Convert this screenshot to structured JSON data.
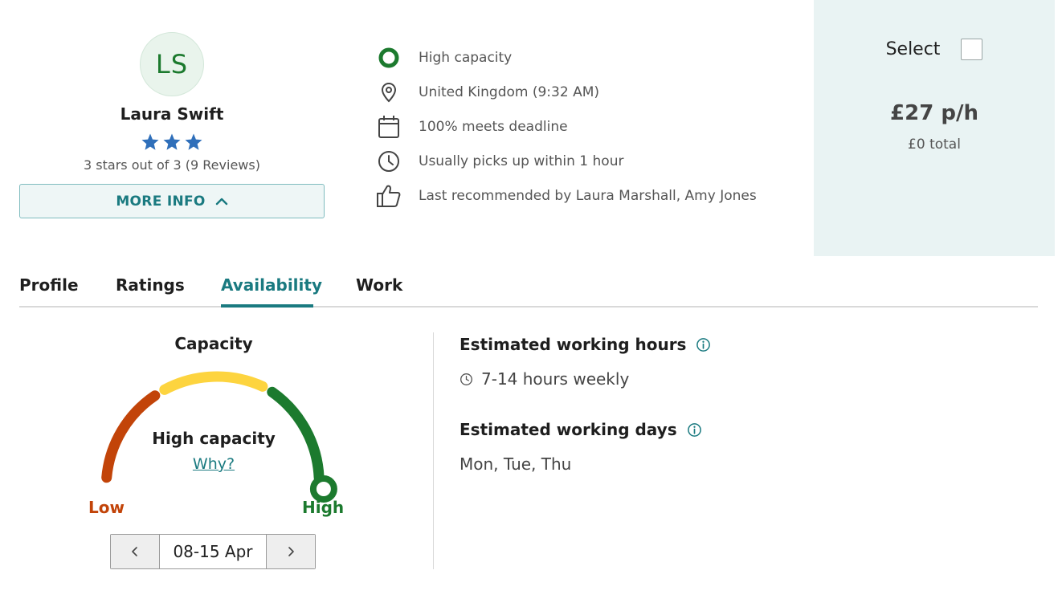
{
  "profile": {
    "initials": "LS",
    "name": "Laura Swift",
    "star_count": 3,
    "rating_text": "3 stars out of 3 (9 Reviews)",
    "more_info_label": "MORE INFO"
  },
  "features": [
    {
      "icon": "capacity-ring-icon",
      "text": "High capacity"
    },
    {
      "icon": "location-pin-icon",
      "text": "United Kingdom (9:32 AM)"
    },
    {
      "icon": "calendar-icon",
      "text": "100% meets deadline"
    },
    {
      "icon": "clock-icon",
      "text": "Usually picks up within 1 hour"
    },
    {
      "icon": "thumbs-up-icon",
      "text": "Last recommended by Laura Marshall, Amy Jones"
    }
  ],
  "selection": {
    "select_label": "Select",
    "checked": false,
    "rate": "£27 p/h",
    "total": "£0 total"
  },
  "tabs": [
    {
      "label": "Profile",
      "active": false
    },
    {
      "label": "Ratings",
      "active": false
    },
    {
      "label": "Availability",
      "active": true
    },
    {
      "label": "Work",
      "active": false
    }
  ],
  "capacity": {
    "title": "Capacity",
    "level_label": "High capacity",
    "why_link": "Why?",
    "low_label": "Low",
    "high_label": "High",
    "level_fraction": 0.85,
    "date_range": "08-15 Apr"
  },
  "working": {
    "hours_heading": "Estimated working hours",
    "hours_value": "7-14 hours weekly",
    "days_heading": "Estimated working days",
    "days_value": "Mon, Tue, Thu"
  },
  "colors": {
    "accent": "#1a7a80",
    "low": "#c24409",
    "medium": "#fdd43f",
    "high": "#1c7a2e",
    "star": "#2f6fba",
    "panel_bg": "#e9f3f3"
  }
}
